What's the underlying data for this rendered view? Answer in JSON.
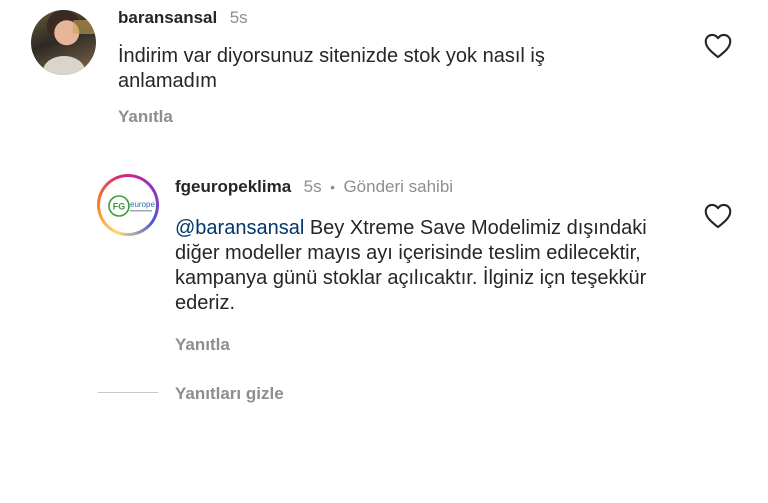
{
  "comment1": {
    "username": "baransansal",
    "time": "5s",
    "text": "İndirim var diyorsunuz sitenizde stok yok nasıl iş anlamadım",
    "reply_label": "Yanıtla",
    "like_icon": "heart-outline-icon"
  },
  "comment2": {
    "username": "fgeuropeklima",
    "time": "5s",
    "separator": "•",
    "author_badge": "Gönderi sahibi",
    "mention": "@baransansal",
    "text": " Bey Xtreme Save Modelimiz dışındaki diğer modeller mayıs ayı içerisinde teslim edilecektir, kampanya günü stoklar açılıcaktır. İlginiz içn teşekkür ederiz.",
    "reply_label": "Yanıtla",
    "like_icon": "heart-outline-icon",
    "logo_text_fg": "FG",
    "logo_text_europe": "europe"
  },
  "hide_replies_label": "Yanıtları gizle"
}
